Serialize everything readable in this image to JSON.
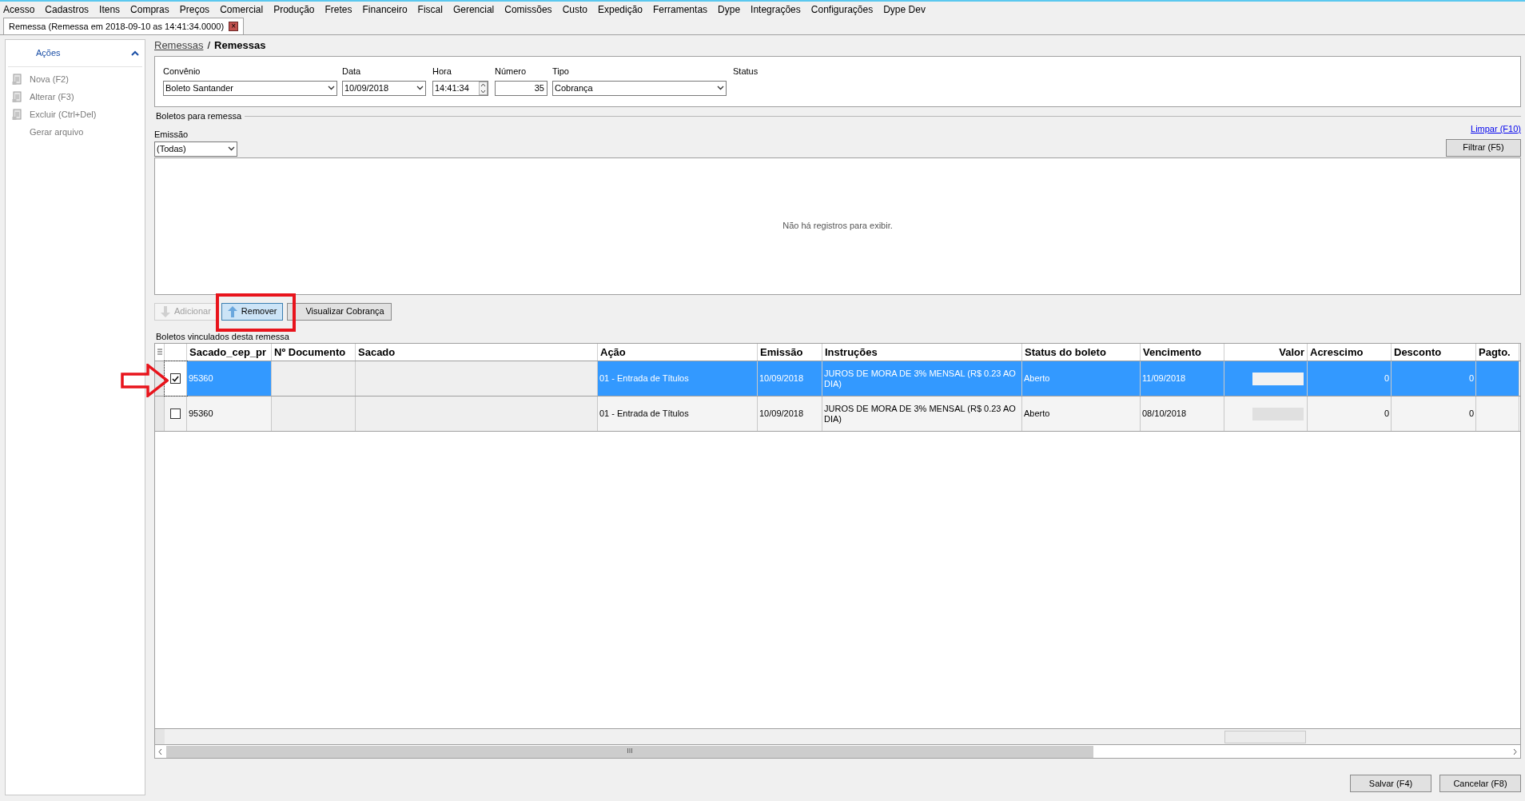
{
  "menu": [
    "Acesso",
    "Cadastros",
    "Itens",
    "Compras",
    "Preços",
    "Comercial",
    "Produção",
    "Fretes",
    "Financeiro",
    "Fiscal",
    "Gerencial",
    "Comissões",
    "Custo",
    "Expedição",
    "Ferramentas",
    "Dype",
    "Integrações",
    "Configurações",
    "Dype Dev"
  ],
  "tab": {
    "title": "Remessa (Remessa em 2018-09-10 as 14:41:34.0000)",
    "close": "×"
  },
  "sidebar": {
    "title": "Ações",
    "expanded": true,
    "items": [
      {
        "label": "Nova (F2)",
        "kind": "document",
        "disabled": true
      },
      {
        "label": "Alterar (F3)",
        "kind": "document",
        "disabled": true
      },
      {
        "label": "Excluir (Ctrl+Del)",
        "kind": "document",
        "disabled": true
      },
      {
        "label": "Gerar arquivo",
        "kind": "plain",
        "disabled": true
      }
    ]
  },
  "breadcrumb": {
    "link": "Remessas",
    "current": "Remessas",
    "separator": "/"
  },
  "form": {
    "convenio": {
      "label": "Convênio",
      "value": "Boleto Santander"
    },
    "data": {
      "label": "Data",
      "value": "10/09/2018"
    },
    "hora": {
      "label": "Hora",
      "value": "14:41:34"
    },
    "numero": {
      "label": "Número",
      "value": "35"
    },
    "tipo": {
      "label": "Tipo",
      "value": "Cobrança"
    },
    "status": {
      "label": "Status"
    }
  },
  "boletos_para_remessa": {
    "title": "Boletos para remessa",
    "emissao": {
      "label": "Emissão",
      "value": "(Todas)"
    },
    "clear_link": "Limpar (F10)",
    "filter_button": "Filtrar (F5)",
    "empty_message": "Não há registros para exibir."
  },
  "actions": [
    {
      "label": "Adicionar",
      "kind": "down",
      "disabled": true,
      "highlighted": false
    },
    {
      "label": "Remover",
      "kind": "up",
      "disabled": false,
      "highlighted": true
    },
    {
      "label": "Visualizar Cobrança",
      "kind": "plain",
      "disabled": false,
      "highlighted": false
    }
  ],
  "linked": {
    "title": "Boletos vinculados desta remessa",
    "columns": [
      {
        "label": "Sacado_cep_pr",
        "kind": "text"
      },
      {
        "label": "Nº Documento",
        "kind": "masked"
      },
      {
        "label": "Sacado",
        "kind": "masked"
      },
      {
        "label": "Ação",
        "kind": "text"
      },
      {
        "label": "Emissão",
        "kind": "text"
      },
      {
        "label": "Instruções",
        "kind": "text"
      },
      {
        "label": "Status do boleto",
        "kind": "text"
      },
      {
        "label": "Vencimento",
        "kind": "text"
      },
      {
        "label": "Valor",
        "kind": "masked_number"
      },
      {
        "label": "Acrescimo",
        "kind": "number"
      },
      {
        "label": "Desconto",
        "kind": "number"
      },
      {
        "label": "Pagto.",
        "kind": "text"
      }
    ],
    "rows": [
      {
        "selected": true,
        "checked": true,
        "cells": [
          "95360",
          null,
          null,
          "01 - Entrada de Títulos",
          "10/09/2018",
          "JUROS DE MORA DE 3% MENSAL (R$ 0.23 AO DIA)",
          "Aberto",
          "11/09/2018",
          null,
          "0",
          "0",
          null
        ]
      },
      {
        "selected": false,
        "checked": false,
        "cells": [
          "95360",
          null,
          null,
          "01 - Entrada de Títulos",
          "10/09/2018",
          "JUROS DE MORA DE 3% MENSAL (R$ 0.23 AO DIA)",
          "Aberto",
          "08/10/2018",
          null,
          "0",
          "0",
          null
        ]
      }
    ],
    "scroll_grip": "III"
  },
  "footer": {
    "save": "Salvar (F4)",
    "cancel": "Cancelar (F8)"
  }
}
